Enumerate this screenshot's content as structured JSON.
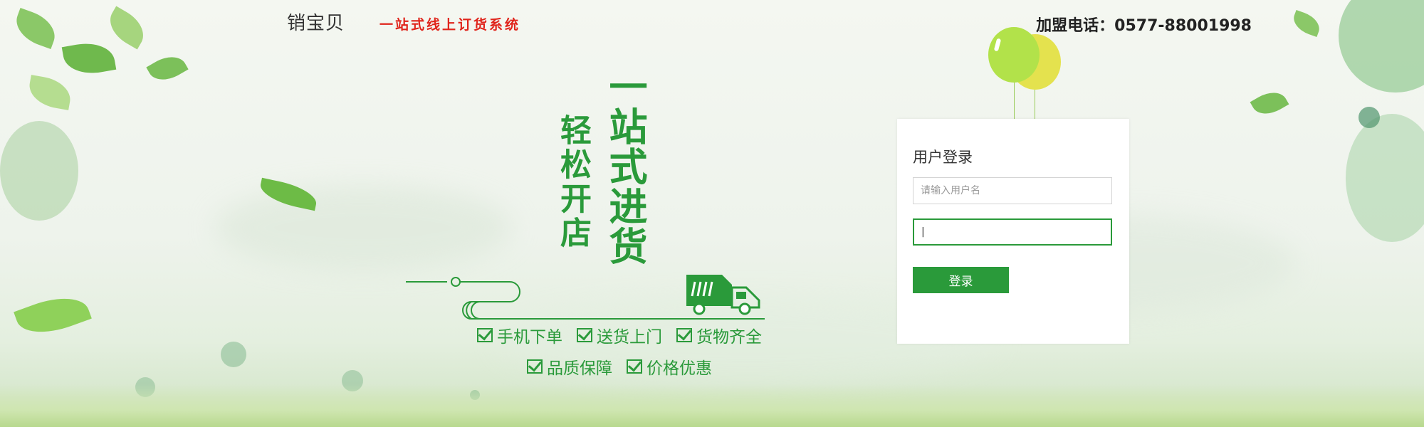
{
  "header": {
    "logo": "销宝贝",
    "slogan": "一站式线上订货系统",
    "phone": "加盟电话：0577-88001998"
  },
  "hero": {
    "line_left": "轻松开店",
    "line_right": "一站式进货"
  },
  "features": {
    "row1": [
      "手机下单",
      "送货上门",
      "货物齐全"
    ],
    "row2": [
      "品质保障",
      "价格优惠"
    ]
  },
  "login": {
    "title": "用户登录",
    "username_placeholder": "请输入用户名",
    "password_value": "|",
    "submit_label": "登录"
  },
  "colors": {
    "brand_green": "#2a9a3a",
    "slogan_red": "#e0241b"
  },
  "icons": [
    "check-icon",
    "truck-icon",
    "balloon-icon",
    "leaf-icon"
  ]
}
